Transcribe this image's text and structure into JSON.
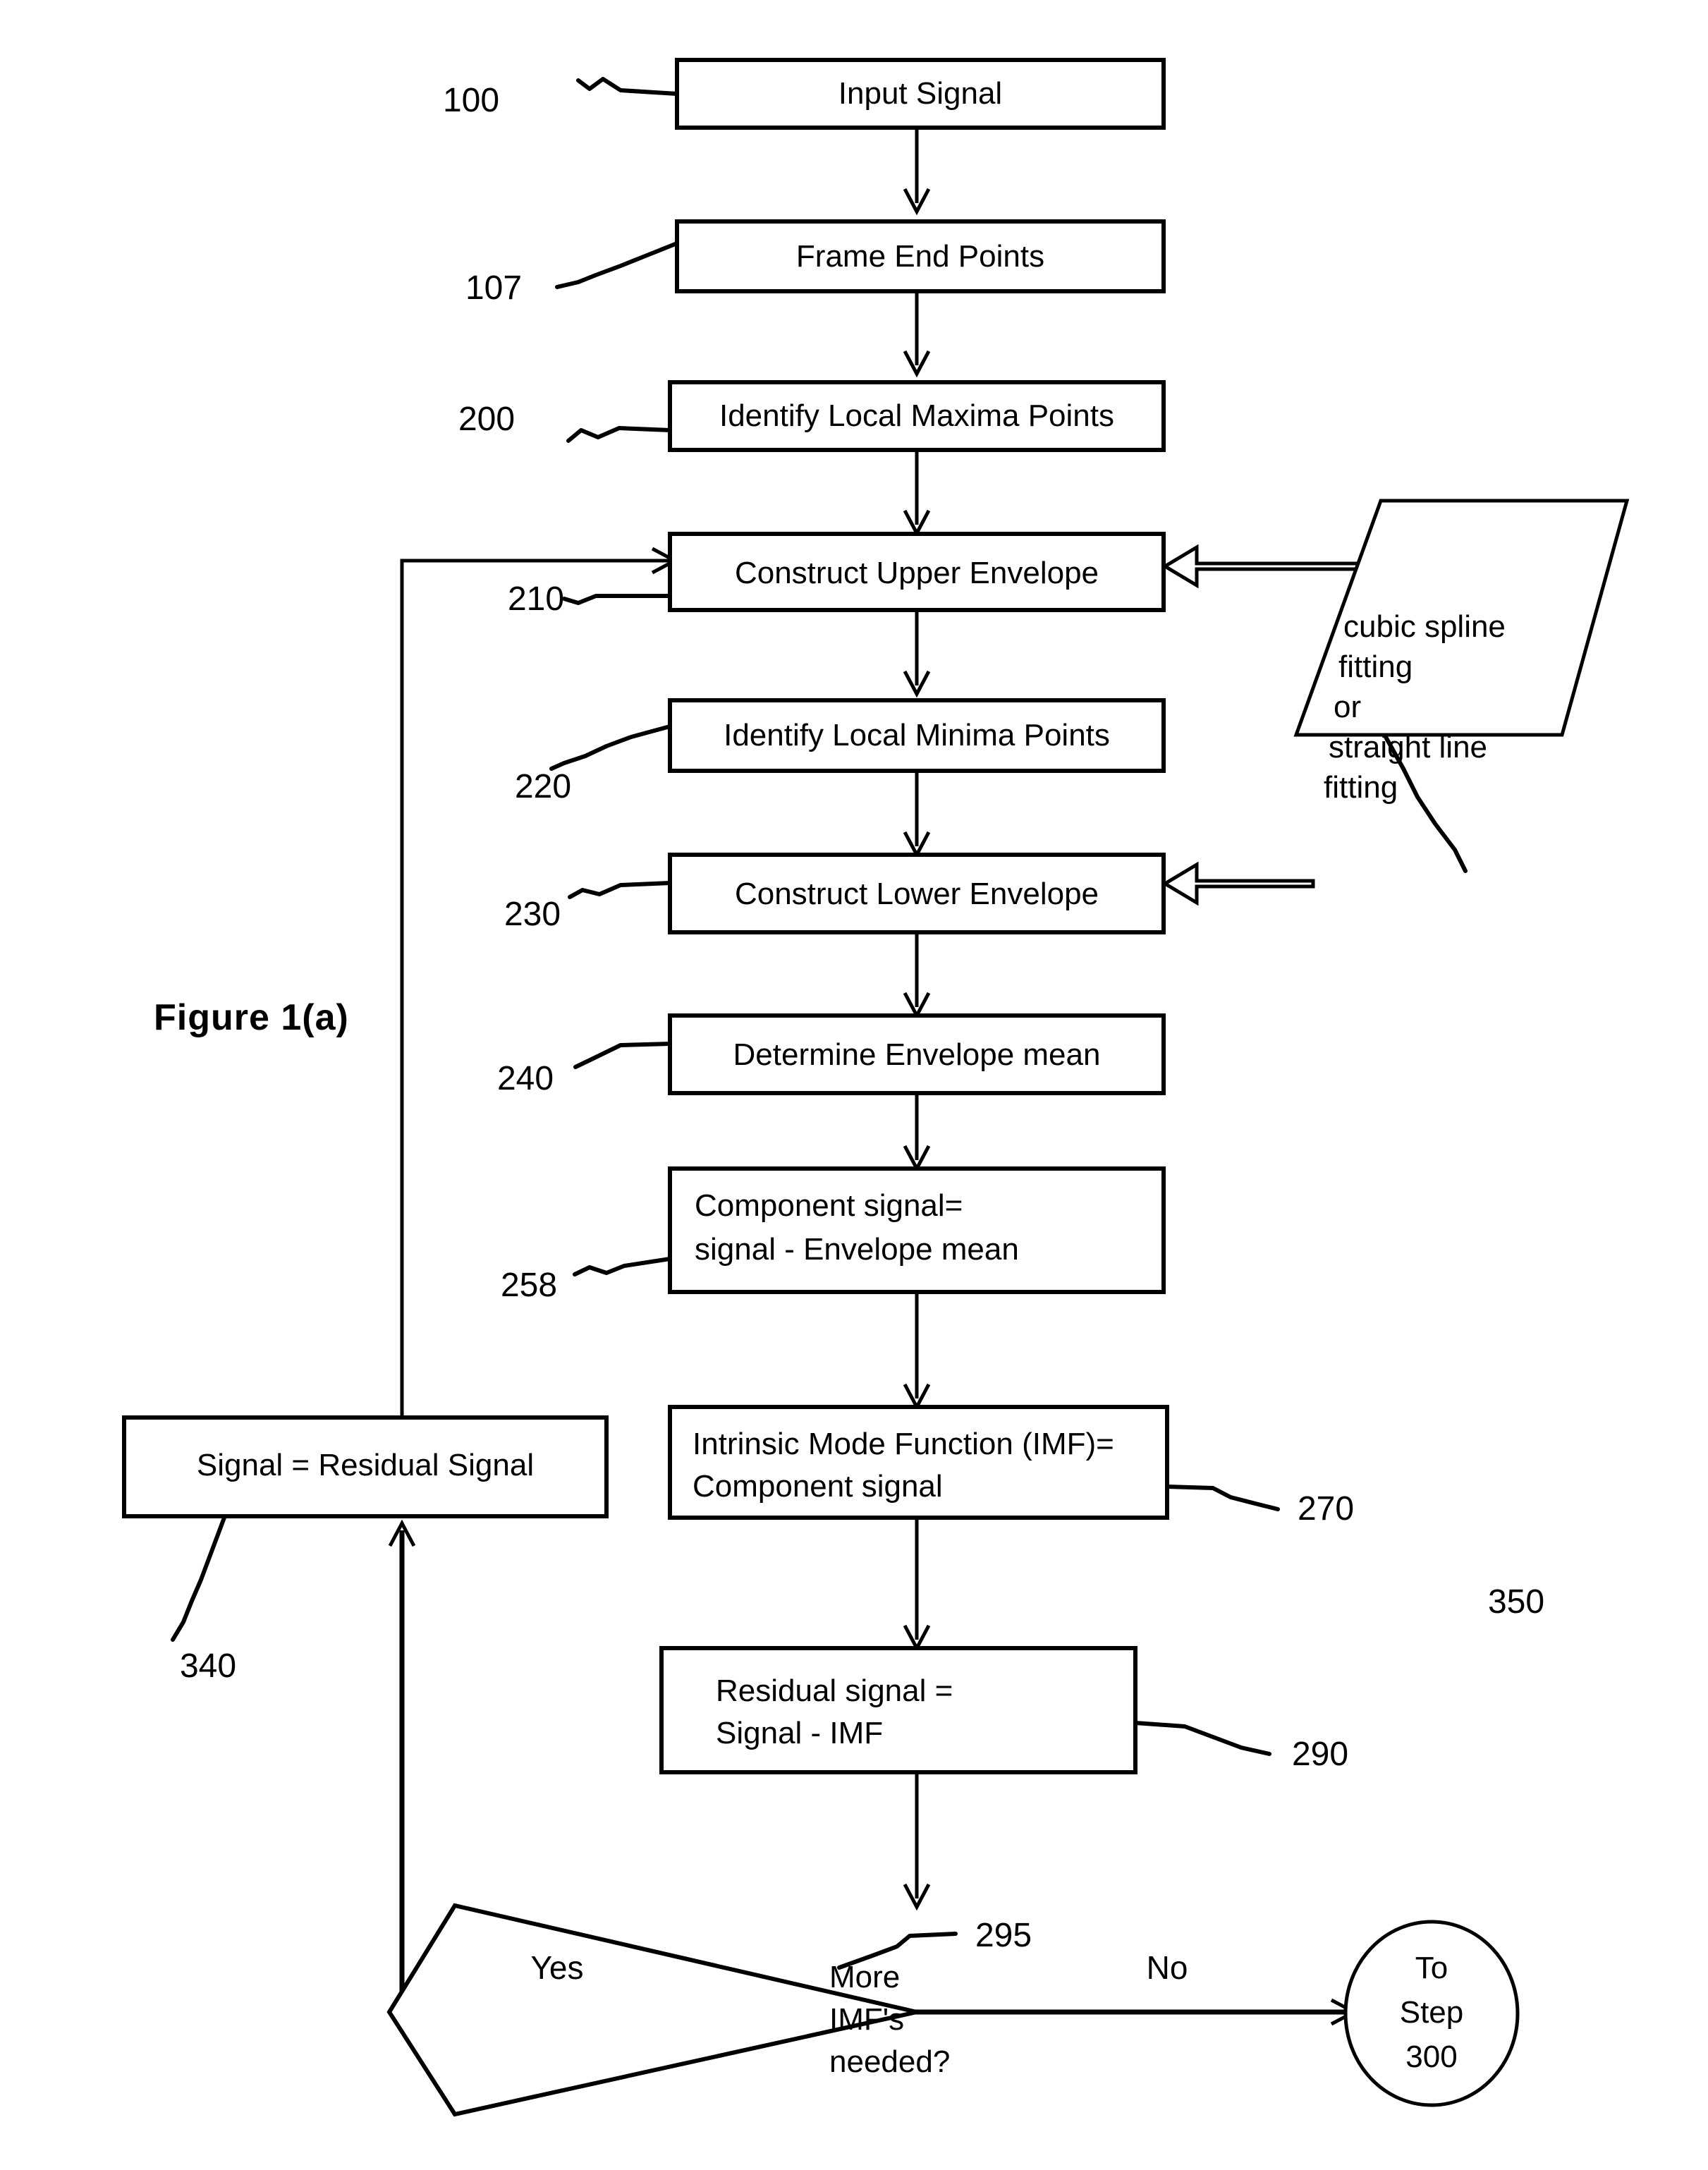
{
  "figure": {
    "label": "Figure 1(a)"
  },
  "nodes": [
    {
      "id": "input_signal",
      "ref": "100",
      "lines": [
        "Input Signal"
      ],
      "shape": "rect",
      "align": "center"
    },
    {
      "id": "frame_end_points",
      "ref": "107",
      "lines": [
        "Frame End Points"
      ],
      "shape": "rect",
      "align": "center"
    },
    {
      "id": "identify_maxima",
      "ref": "200",
      "lines": [
        "Identify Local Maxima Points"
      ],
      "shape": "rect",
      "align": "center"
    },
    {
      "id": "upper_envelope",
      "ref": "210",
      "lines": [
        "Construct Upper Envelope"
      ],
      "shape": "rect",
      "align": "center"
    },
    {
      "id": "identify_minima",
      "ref": "220",
      "lines": [
        "Identify Local Minima Points"
      ],
      "shape": "rect",
      "align": "center"
    },
    {
      "id": "lower_envelope",
      "ref": "230",
      "lines": [
        "Construct Lower Envelope"
      ],
      "shape": "rect",
      "align": "center"
    },
    {
      "id": "envelope_mean",
      "ref": "240",
      "lines": [
        "Determine Envelope mean"
      ],
      "shape": "rect",
      "align": "center"
    },
    {
      "id": "component_signal",
      "ref": "258",
      "lines": [
        "Component signal=",
        "signal - Envelope mean"
      ],
      "shape": "rect",
      "align": "left"
    },
    {
      "id": "imf",
      "ref": "270",
      "lines": [
        "Intrinsic Mode Function (IMF)=",
        "Component signal"
      ],
      "shape": "rect",
      "align": "left"
    },
    {
      "id": "residual_signal",
      "ref": "290",
      "lines": [
        "Residual signal =",
        "Signal - IMF"
      ],
      "shape": "rect",
      "align": "left"
    },
    {
      "id": "more_imfs",
      "ref": "295",
      "lines": [
        "More",
        "IMF's",
        "needed?"
      ],
      "shape": "diamond",
      "align": "left"
    },
    {
      "id": "signal_is_residual",
      "ref": "340",
      "lines": [
        "Signal = Residual Signal"
      ],
      "shape": "rect",
      "align": "center"
    },
    {
      "id": "fitting_method",
      "ref": "350",
      "lines": [
        "cubic spline",
        "fitting",
        "or",
        "straight line",
        "fitting"
      ],
      "shape": "parallelogram",
      "align": "left"
    },
    {
      "id": "to_step_300",
      "ref": "",
      "lines": [
        "To",
        "Step",
        "300"
      ],
      "shape": "ellipse",
      "align": "center"
    }
  ],
  "edge_labels": {
    "yes": "Yes",
    "no": "No"
  },
  "colors": {
    "line": "#000000",
    "fill": "#ffffff",
    "text": "#000000"
  }
}
